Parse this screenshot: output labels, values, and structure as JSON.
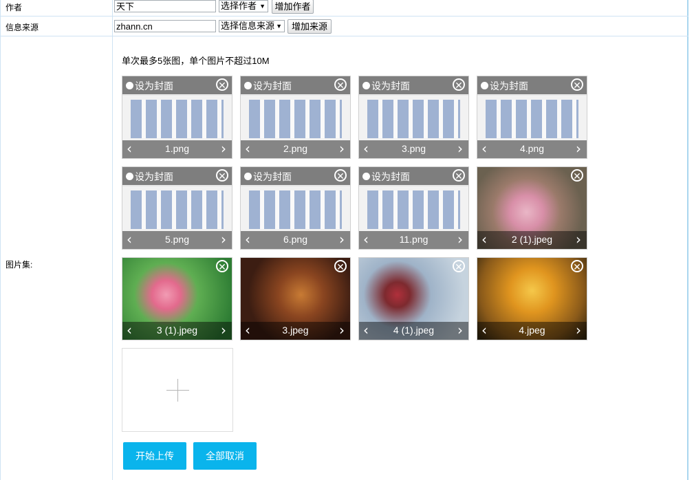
{
  "form": {
    "author": {
      "label": "作者",
      "value": "天下",
      "select": "选择作者",
      "button": "增加作者"
    },
    "source": {
      "label": "信息来源",
      "value": "zhann.cn",
      "select": "选择信息来源",
      "button": "增加来源"
    },
    "gallery": {
      "label": "图片集:"
    }
  },
  "upload": {
    "hint": "单次最多5张图，单个图片不超过10M",
    "set_cover_label": "设为封面",
    "start_button": "开始上传",
    "cancel_button": "全部取消",
    "images": [
      {
        "name": "1.png",
        "cover": true,
        "style": "screenshot"
      },
      {
        "name": "2.png",
        "cover": true,
        "style": "screenshot"
      },
      {
        "name": "3.png",
        "cover": true,
        "style": "screenshot"
      },
      {
        "name": "4.png",
        "cover": true,
        "style": "screenshot"
      },
      {
        "name": "5.png",
        "cover": true,
        "style": "screenshot"
      },
      {
        "name": "6.png",
        "cover": true,
        "style": "screenshot"
      },
      {
        "name": "11.png",
        "cover": true,
        "style": "screenshot"
      },
      {
        "name": "2 (1).jpeg",
        "cover": false,
        "style": "flowers"
      },
      {
        "name": "3 (1).jpeg",
        "cover": false,
        "style": "blossom"
      },
      {
        "name": "3.jpeg",
        "cover": false,
        "style": "autumn-bench"
      },
      {
        "name": "4 (1).jpeg",
        "cover": false,
        "style": "rose"
      },
      {
        "name": "4.jpeg",
        "cover": false,
        "style": "autumn-forest"
      }
    ]
  }
}
